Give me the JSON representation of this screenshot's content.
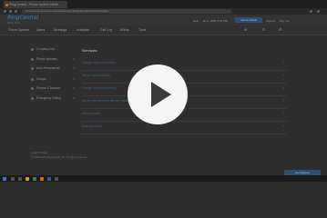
{
  "browser": {
    "tab_title": "RingCentral - Phone system admin",
    "url": "service.ringcentral.com/application/company/phoneSystem/company"
  },
  "header": {
    "logo": "RingCentral",
    "logo_sub": "Admin Portal",
    "help_label": "Help",
    "date_label": "Jan 6, 2021 5:23 PM",
    "admin_button": "Admin Portal",
    "support_label": "Support",
    "user_label": "Ying Yue"
  },
  "topnav": {
    "items": [
      "Phone System",
      "Users",
      "Meetings",
      "Analytics",
      "Call Log",
      "Billing",
      "Tools"
    ]
  },
  "sidebar": {
    "items": [
      {
        "label": "Company Info"
      },
      {
        "label": "Phone Numbers"
      },
      {
        "label": "Auto-Receptionist"
      },
      {
        "label": "Groups"
      },
      {
        "label": "Phones & Devices"
      },
      {
        "label": "Emergency Calling"
      }
    ]
  },
  "panel": {
    "title": "Services",
    "rows": [
      "Change ring-to-hold setup",
      "Set up call forwarding",
      "Change company greeting",
      "Set up hold music for the call queue",
      "Set call queue",
      "Business hours"
    ]
  },
  "footer": {
    "line1": "Legal | Privacy",
    "line2": "© 1999-2021 RingCentral, Inc. All rights reserved."
  },
  "support_button": "Get Support",
  "colors": {
    "accent": "#2b4d78",
    "link": "#3e5f86",
    "play_button": "#f5f5f5"
  }
}
